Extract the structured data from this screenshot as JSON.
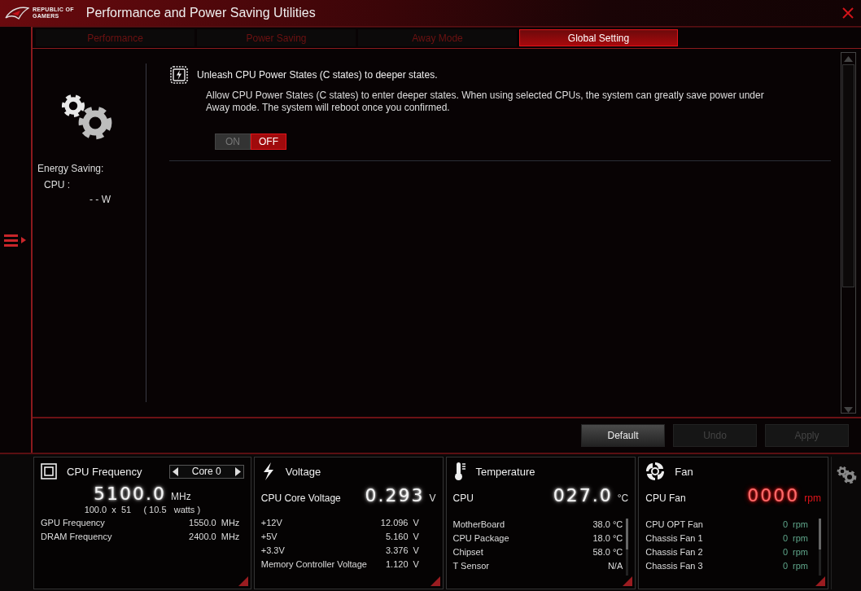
{
  "window": {
    "logo_text": [
      "REPUBLIC OF",
      "GAMERS"
    ],
    "title": "Performance and Power Saving Utilities"
  },
  "tabs": [
    {
      "label": "Performance",
      "selected": false
    },
    {
      "label": "Power Saving",
      "selected": false
    },
    {
      "label": "Away Mode",
      "selected": false
    },
    {
      "label": "Global Setting",
      "selected": true
    }
  ],
  "sidebar": {
    "heading": "Energy Saving:",
    "cpu_label": "CPU :",
    "cpu_value": "- - W"
  },
  "setting": {
    "title": "Unleash CPU Power States (C states) to deeper states.",
    "description": "Allow CPU Power States (C states) to enter deeper states. When using selected CPUs, the system can greatly save power under Away mode. The system will reboot once you confirmed.",
    "options": [
      {
        "label": "ON",
        "selected": false
      },
      {
        "label": "OFF",
        "selected": true
      }
    ]
  },
  "buttons": [
    {
      "label": "Default",
      "disabled": false
    },
    {
      "label": "Undo",
      "disabled": true
    },
    {
      "label": "Apply",
      "disabled": true
    }
  ],
  "monitors": [
    {
      "kind": "frequency",
      "title": "CPU Frequency",
      "selector": "Core 0",
      "value": "5100.0",
      "unit": "MHz",
      "alert": false,
      "detail": "100.0  x  51     ( 10.5   watts )",
      "rows": [
        {
          "label": "GPU Frequency",
          "value": "1550.0",
          "unit": "MHz"
        },
        {
          "label": "DRAM Frequency",
          "value": "2400.0",
          "unit": "MHz"
        }
      ]
    },
    {
      "kind": "voltage",
      "title": "Voltage",
      "main_label": "CPU Core Voltage",
      "value": "0.293",
      "unit": "V",
      "alert": false,
      "rows": [
        {
          "label": "+12V",
          "value": "12.096",
          "unit": "V"
        },
        {
          "label": "+5V",
          "value": "5.160",
          "unit": "V"
        },
        {
          "label": "+3.3V",
          "value": "3.376",
          "unit": "V"
        },
        {
          "label": "Memory Controller Voltage",
          "value": "1.120",
          "unit": "V"
        }
      ]
    },
    {
      "kind": "temperature",
      "title": "Temperature",
      "main_label": "CPU",
      "value": "027.0",
      "unit": "°C",
      "alert": false,
      "rows": [
        {
          "label": "MotherBoard",
          "value": "38.0 °C"
        },
        {
          "label": "CPU Package",
          "value": "18.0 °C"
        },
        {
          "label": "Chipset",
          "value": "58.0 °C"
        },
        {
          "label": "T Sensor",
          "value": "N/A"
        }
      ]
    },
    {
      "kind": "fan",
      "title": "Fan",
      "main_label": "CPU Fan",
      "value": "0000",
      "unit": "rpm",
      "alert": true,
      "rows": [
        {
          "label": "CPU OPT Fan",
          "value": "0",
          "unit": "rpm"
        },
        {
          "label": "Chassis Fan 1",
          "value": "0",
          "unit": "rpm"
        },
        {
          "label": "Chassis Fan 2",
          "value": "0",
          "unit": "rpm"
        },
        {
          "label": "Chassis Fan 3",
          "value": "0",
          "unit": "rpm"
        }
      ]
    }
  ]
}
